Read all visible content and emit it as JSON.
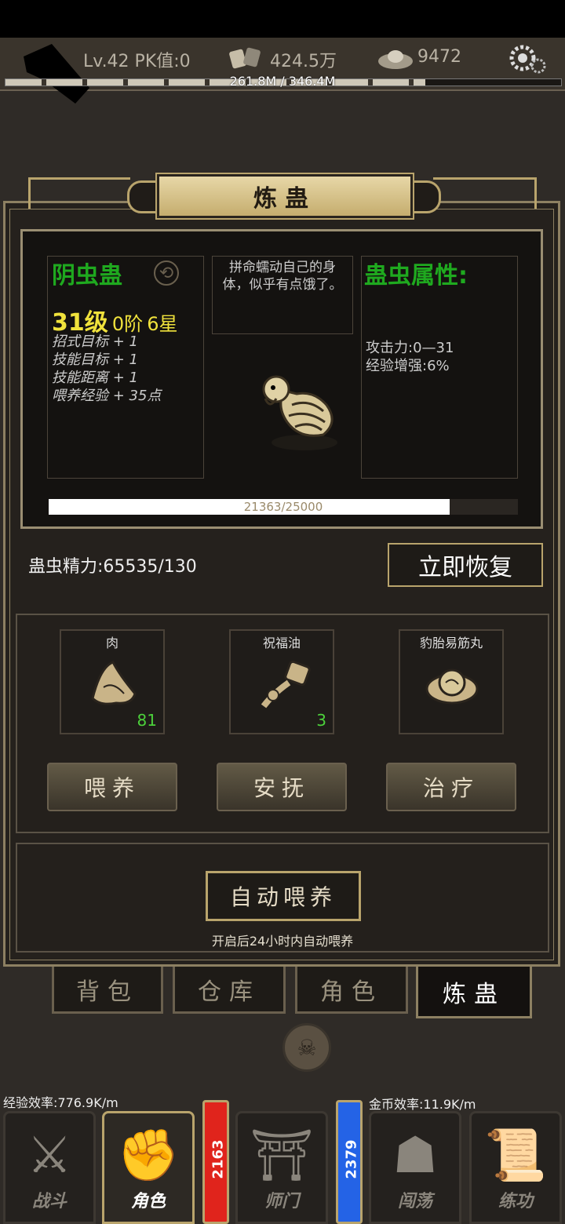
{
  "hud": {
    "level_pk": "Lv.42 PK值:0",
    "silver": "424.5万",
    "gold": "9472",
    "xp": "261.8M / 346.4M",
    "xp_fraction": 0.756
  },
  "title": "炼蛊",
  "gu": {
    "name": "阴虫蛊",
    "level": "31级",
    "rank": "0阶",
    "stars": "6星",
    "bonuses": [
      "招式目标 + 1",
      "技能目标 + 1",
      "技能距离 + 1",
      "喂养经验 + 35点"
    ],
    "description": "拼命蠕动自己的身体，似乎有点饿了。",
    "attr_title": "蛊虫属性:",
    "attrs": [
      "攻击力:0—31",
      "经验增强:6%"
    ],
    "progress": "21363/25000",
    "progress_fraction": 0.855
  },
  "energy": "蛊虫精力:65535/130",
  "recover_label": "立即恢复",
  "items": [
    {
      "name": "肉",
      "count": "81",
      "icon": "meat-icon"
    },
    {
      "name": "祝福油",
      "count": "3",
      "icon": "oil-icon"
    },
    {
      "name": "豹胎易筋丸",
      "count": "",
      "icon": "pill-icon"
    }
  ],
  "actions": [
    "喂养",
    "安抚",
    "治疗"
  ],
  "auto_feed_label": "自动喂养",
  "auto_feed_note": "开启后24小时内自动喂养",
  "tabs": [
    "背包",
    "仓库",
    "角色",
    "炼蛊"
  ],
  "exp_rate": "经验效率:776.9K/m",
  "gold_rate": "金币效率:11.9K/m",
  "nav": [
    "战斗",
    "角色",
    "师门",
    "闯荡",
    "练功"
  ],
  "red_count": "2163",
  "blue_count": "2379",
  "colors": {
    "accent": "#b9a46c",
    "green": "#1fa91f",
    "yellow": "#f0e23c"
  }
}
